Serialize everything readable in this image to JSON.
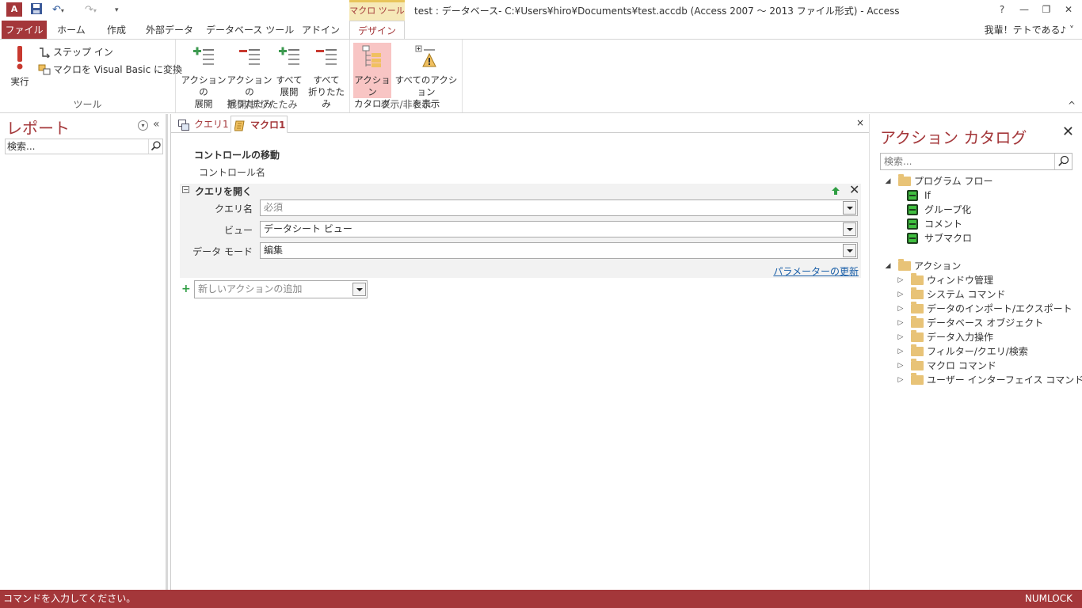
{
  "titlebar": {
    "app_icon": "A",
    "tool_context": "マクロ ツール",
    "title": "test : データベース- C:¥Users¥hiro¥Documents¥test.accdb (Access 2007 ～ 2013 ファイル形式) - Access",
    "help": "?",
    "minimize": "—",
    "restore": "❐",
    "close": "✕"
  },
  "ribbon_tabs": {
    "file": "ファイル",
    "home": "ホーム",
    "create": "作成",
    "external": "外部データ",
    "dbtools": "データベース ツール",
    "addin": "アドイン",
    "design": "デザイン",
    "user": "我輩！テトである♪ ˅"
  },
  "ribbon": {
    "tools": {
      "run": "実行",
      "step_in": "ステップ イン",
      "convert": "マクロを Visual Basic に変換",
      "label": "ツール"
    },
    "expand_collapse": {
      "expand_action": [
        "アクションの",
        "展開"
      ],
      "collapse_action": [
        "アクションの",
        "折りたたみ"
      ],
      "expand_all": [
        "すべて",
        "展開"
      ],
      "collapse_all": [
        "すべて",
        "折りたたみ"
      ],
      "label": "展開/折りたたみ"
    },
    "show_hide": {
      "catalog": [
        "アクション",
        "カタログ"
      ],
      "show_all": [
        "すべてのアクション",
        "を表示"
      ],
      "label": "表示/非表示"
    },
    "collapse": "^"
  },
  "nav": {
    "title": "レポート",
    "search_placeholder": "検索...",
    "collapse": "«"
  },
  "doc": {
    "tabs": [
      "クエリ1",
      "マクロ1"
    ],
    "close": "×",
    "move_control": "コントロールの移動",
    "move_control_arg": "コントロール名",
    "action": {
      "name": "クエリを開く",
      "args": [
        {
          "label": "クエリ名",
          "value": "必須"
        },
        {
          "label": "ビュー",
          "value": "データシート ビュー"
        },
        {
          "label": "データ モード",
          "value": "編集"
        }
      ],
      "update_params": "パラメーターの更新"
    },
    "add_action_placeholder": "新しいアクションの追加"
  },
  "catalog": {
    "title": "アクション カタログ",
    "search_placeholder": "検索...",
    "program_flow": "プログラム フロー",
    "flow_items": [
      "If",
      "グループ化",
      "コメント",
      "サブマクロ"
    ],
    "actions": "アクション",
    "action_folders": [
      "ウィンドウ管理",
      "システム コマンド",
      "データのインポート/エクスポート",
      "データベース オブジェクト",
      "データ入力操作",
      "フィルター/クエリ/検索",
      "マクロ コマンド",
      "ユーザー インターフェイス コマンド"
    ]
  },
  "status": {
    "text": "コマンドを入力してください。",
    "numlock": "NUMLOCK"
  },
  "colors": {
    "accent": "#a4373a",
    "link": "#1a5fa8",
    "folder": "#e8c377",
    "green": "#3fbf3f"
  }
}
